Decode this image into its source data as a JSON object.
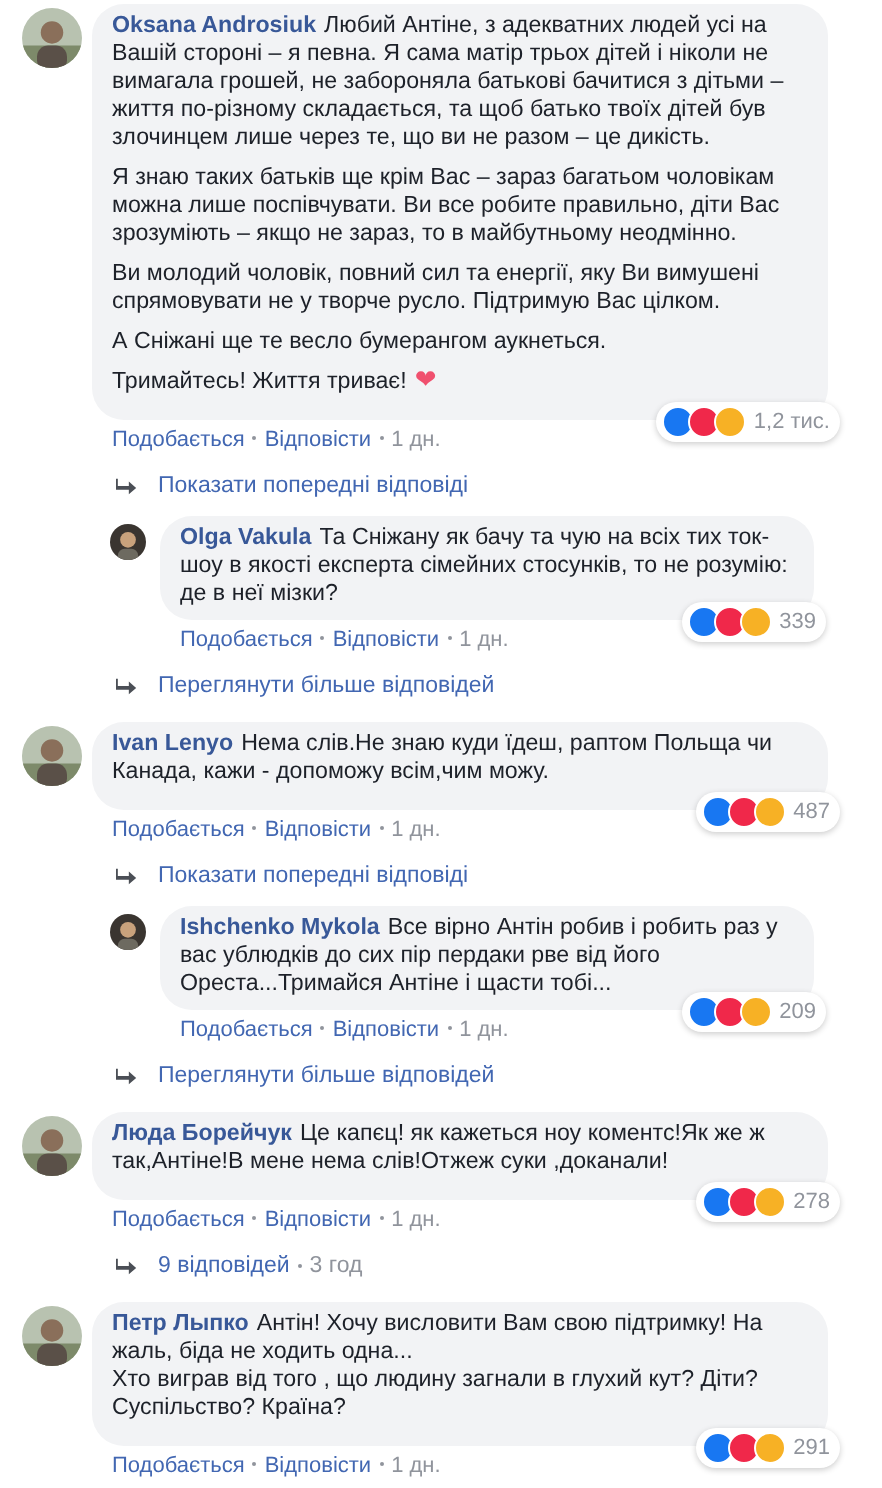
{
  "comments": [
    {
      "kind": "comment",
      "author": "Oksana Androsiuk",
      "paragraphs": [
        "Любий Антіне, з адекватних людей усі на Вашій стороні – я певна. Я сама матір трьох дітей і ніколи не вимагала грошей, не забороняла батькові бачитися з дітьми – життя по-різному складається, та щоб батько твоїх дітей був злочинцем лише через те, що ви не разом – це дикість.",
        "Я знаю таких батьків ще крім Вас – зараз багатьом чоловікам можна лише поспівчувати. Ви все робите правильно, діти Вас зрозуміють – якщо не зараз, то в майбутньому неодмінно.",
        "Ви молодий чоловік, повний сил та енергії, яку Ви вимушені спрямовувати не у творче русло. Підтримую Вас цілком.",
        "А Сніжані ще те весло бумерангом аукнеться.",
        "Тримайтесь! Життя триває!"
      ],
      "trailing_emoji": "❤",
      "count": "1,2 тис.",
      "like": "Подобається",
      "reply": "Відповісти",
      "time": "1 дн.",
      "children": [
        {
          "kind": "link",
          "text": "Показати попередні відповіді"
        },
        {
          "kind": "comment",
          "author": "Olga Vakula",
          "paragraphs": [
            "Та Сніжану як бачу та чую на всіх тих ток-шоу в якості експерта сімейних стосунків, то не розумію: де в неї мізки?"
          ],
          "count": "339",
          "like": "Подобається",
          "reply": "Відповісти",
          "time": "1 дн."
        },
        {
          "kind": "link",
          "text": "Переглянути більше відповідей"
        }
      ]
    },
    {
      "kind": "comment",
      "author": "Ivan Lenyo",
      "paragraphs": [
        "Нема слів.Не знаю куди їдеш, раптом Польща чи Канада, кажи - допоможу всім,чим можу."
      ],
      "count": "487",
      "like": "Подобається",
      "reply": "Відповісти",
      "time": "1 дн.",
      "children": [
        {
          "kind": "link",
          "text": "Показати попередні відповіді"
        },
        {
          "kind": "comment",
          "author": "Ishchenko Mykola",
          "paragraphs": [
            "Все вірно Антін робив і робить раз у вас ублюдків до сих пір пердаки рве від його Ореста...Тримайся Антіне і щасти тобі..."
          ],
          "count": "209",
          "like": "Подобається",
          "reply": "Відповісти",
          "time": "1 дн."
        },
        {
          "kind": "link",
          "text": "Переглянути більше відповідей"
        }
      ]
    },
    {
      "kind": "comment",
      "author": "Люда Борейчук",
      "paragraphs": [
        "Це капєц! як кажеться ноу коментс!Як же ж так,Антіне!В мене нема слів!Отжеж суки ,доканали!"
      ],
      "count": "278",
      "like": "Подобається",
      "reply": "Відповісти",
      "time": "1 дн.",
      "children": [
        {
          "kind": "link",
          "text": "9 відповідей",
          "time": "3 год"
        }
      ]
    },
    {
      "kind": "comment",
      "author": "Петр Лыпко",
      "paragraphs": [
        "Антін! Хочу висловити Вам свою підтримку! На жаль, біда не ходить одна...\nХто виграв від того , що людину загнали в глухий кут? Діти? Суспільство? Країна?"
      ],
      "count": "291",
      "like": "Подобається",
      "reply": "Відповісти",
      "time": "1 дн."
    }
  ]
}
